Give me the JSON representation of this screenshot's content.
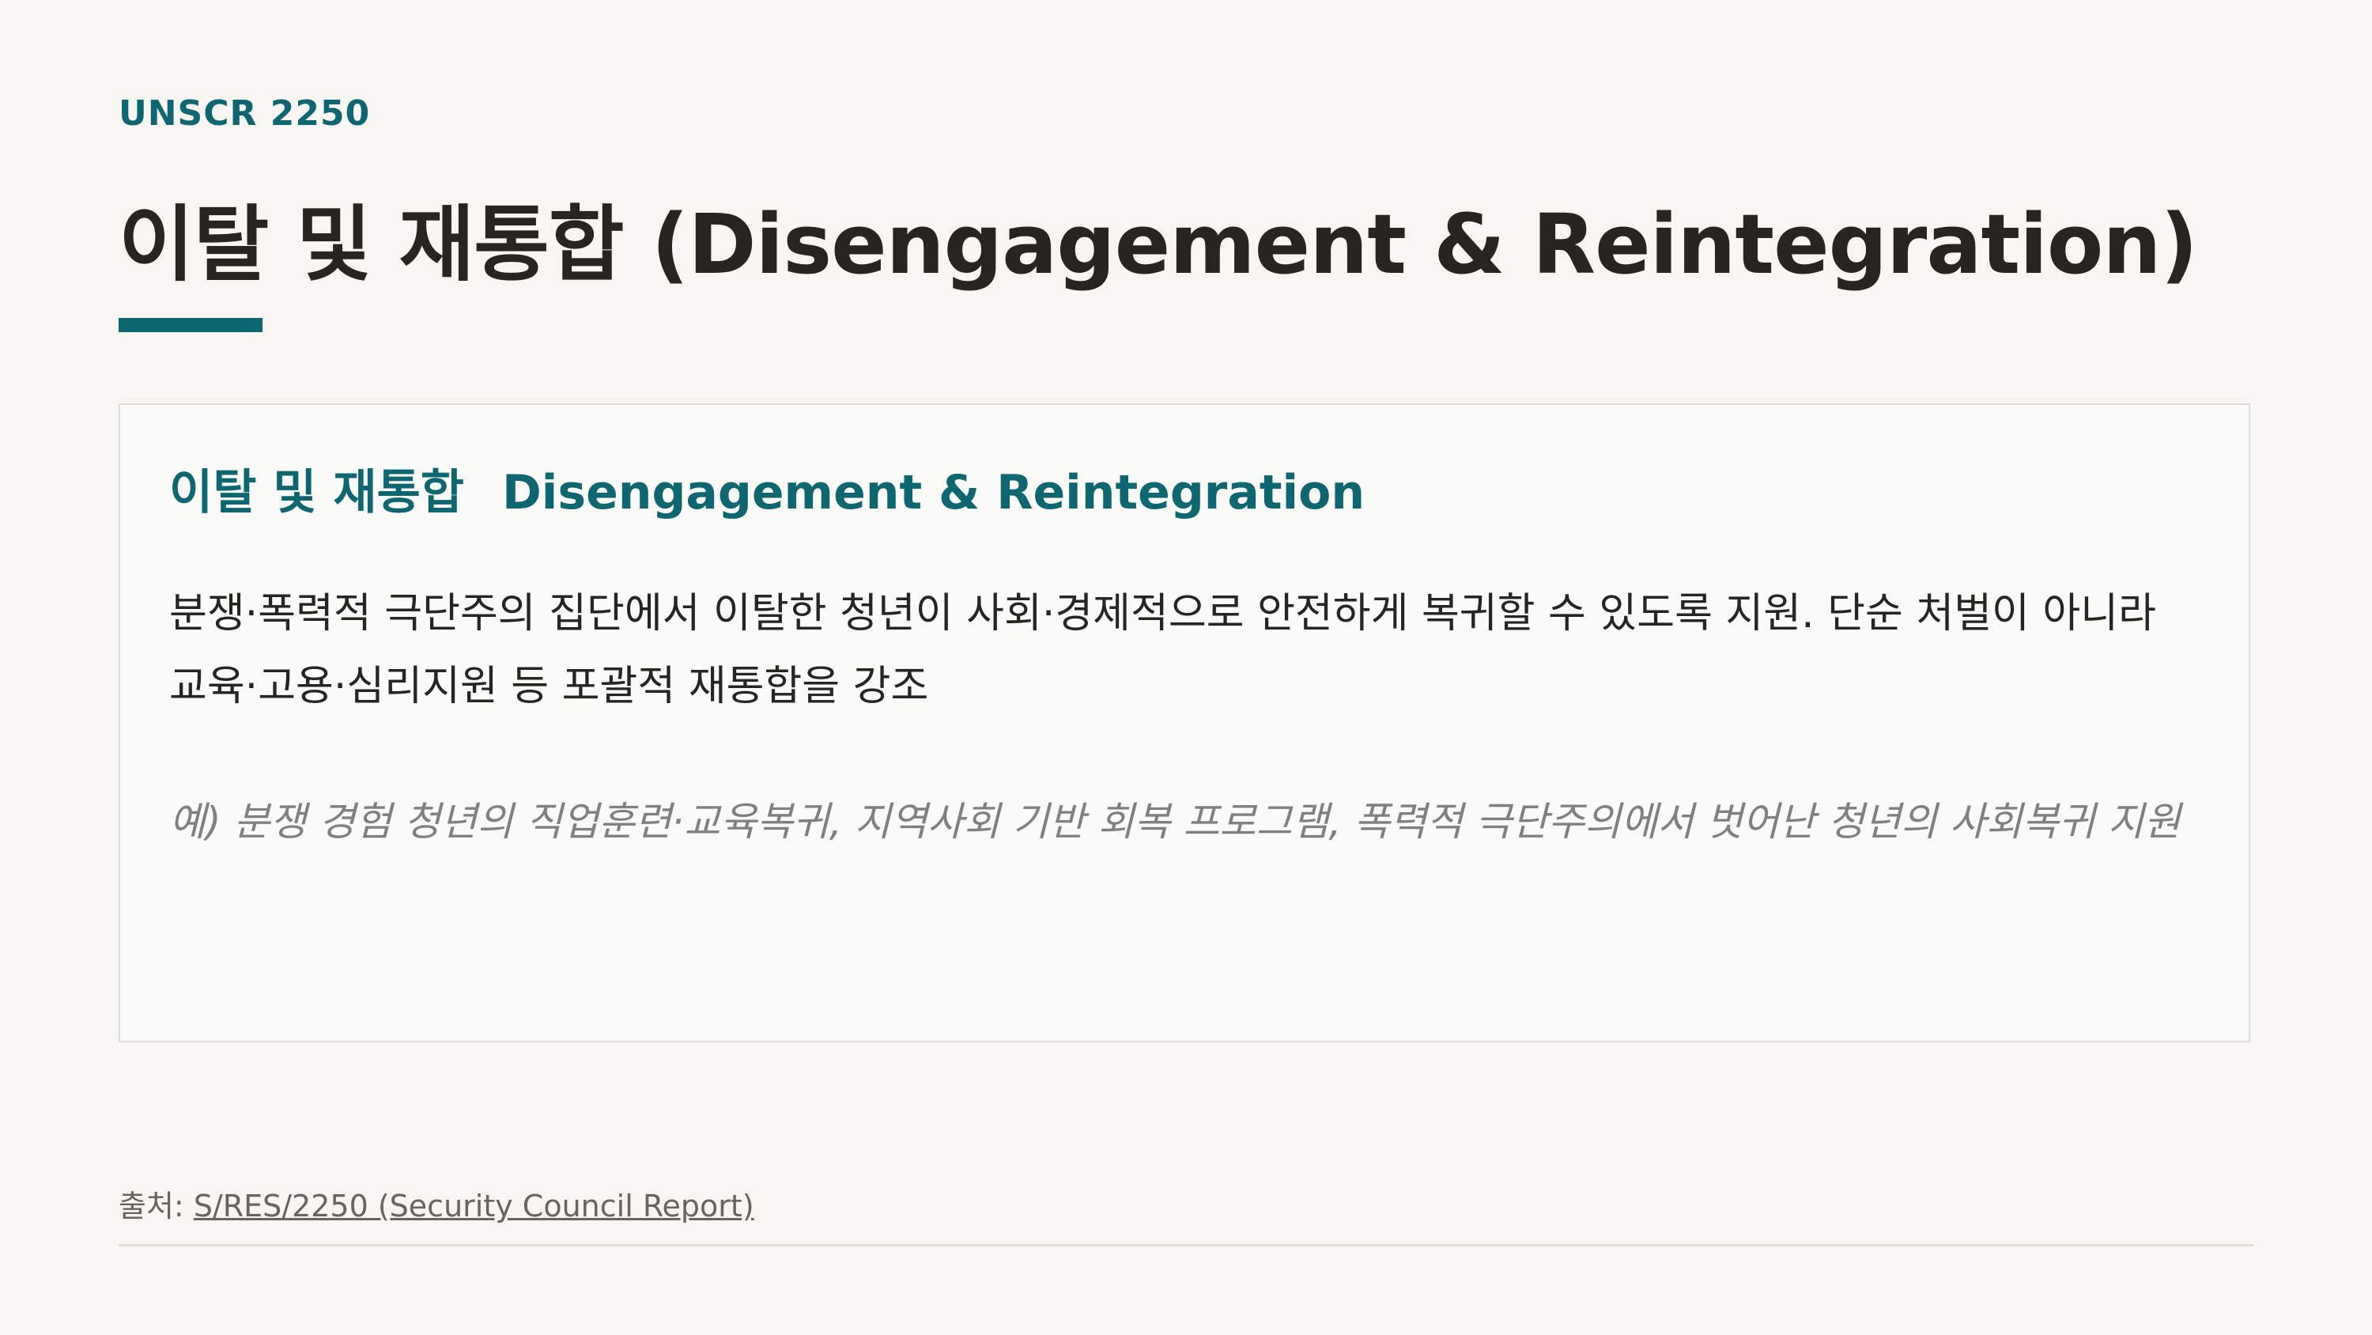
{
  "header": {
    "kicker": "UNSCR 2250",
    "title": "이탈 및 재통합 (Disengagement & Reintegration)"
  },
  "card": {
    "heading_ko": "이탈 및 재통합",
    "heading_en": "Disengagement & Reintegration",
    "body": "분쟁·폭력적 극단주의 집단에서 이탈한 청년이 사회·경제적으로 안전하게 복귀할 수 있도록 지원. 단순 처벌이 아니라 교육·고용·심리지원 등 포괄적 재통합을 강조",
    "example": "예) 분쟁 경험 청년의 직업훈련·교육복귀, 지역사회 기반 회복 프로그램, 폭력적 극단주의에서 벗어난 청년의 사회복귀 지원"
  },
  "footer": {
    "source_label": "출처: ",
    "source_link": "S/RES/2250 (Security Council Report)"
  },
  "colors": {
    "accent": "#0d6670",
    "text": "#26251f",
    "muted": "#808080",
    "background": "#f7f6f2"
  }
}
